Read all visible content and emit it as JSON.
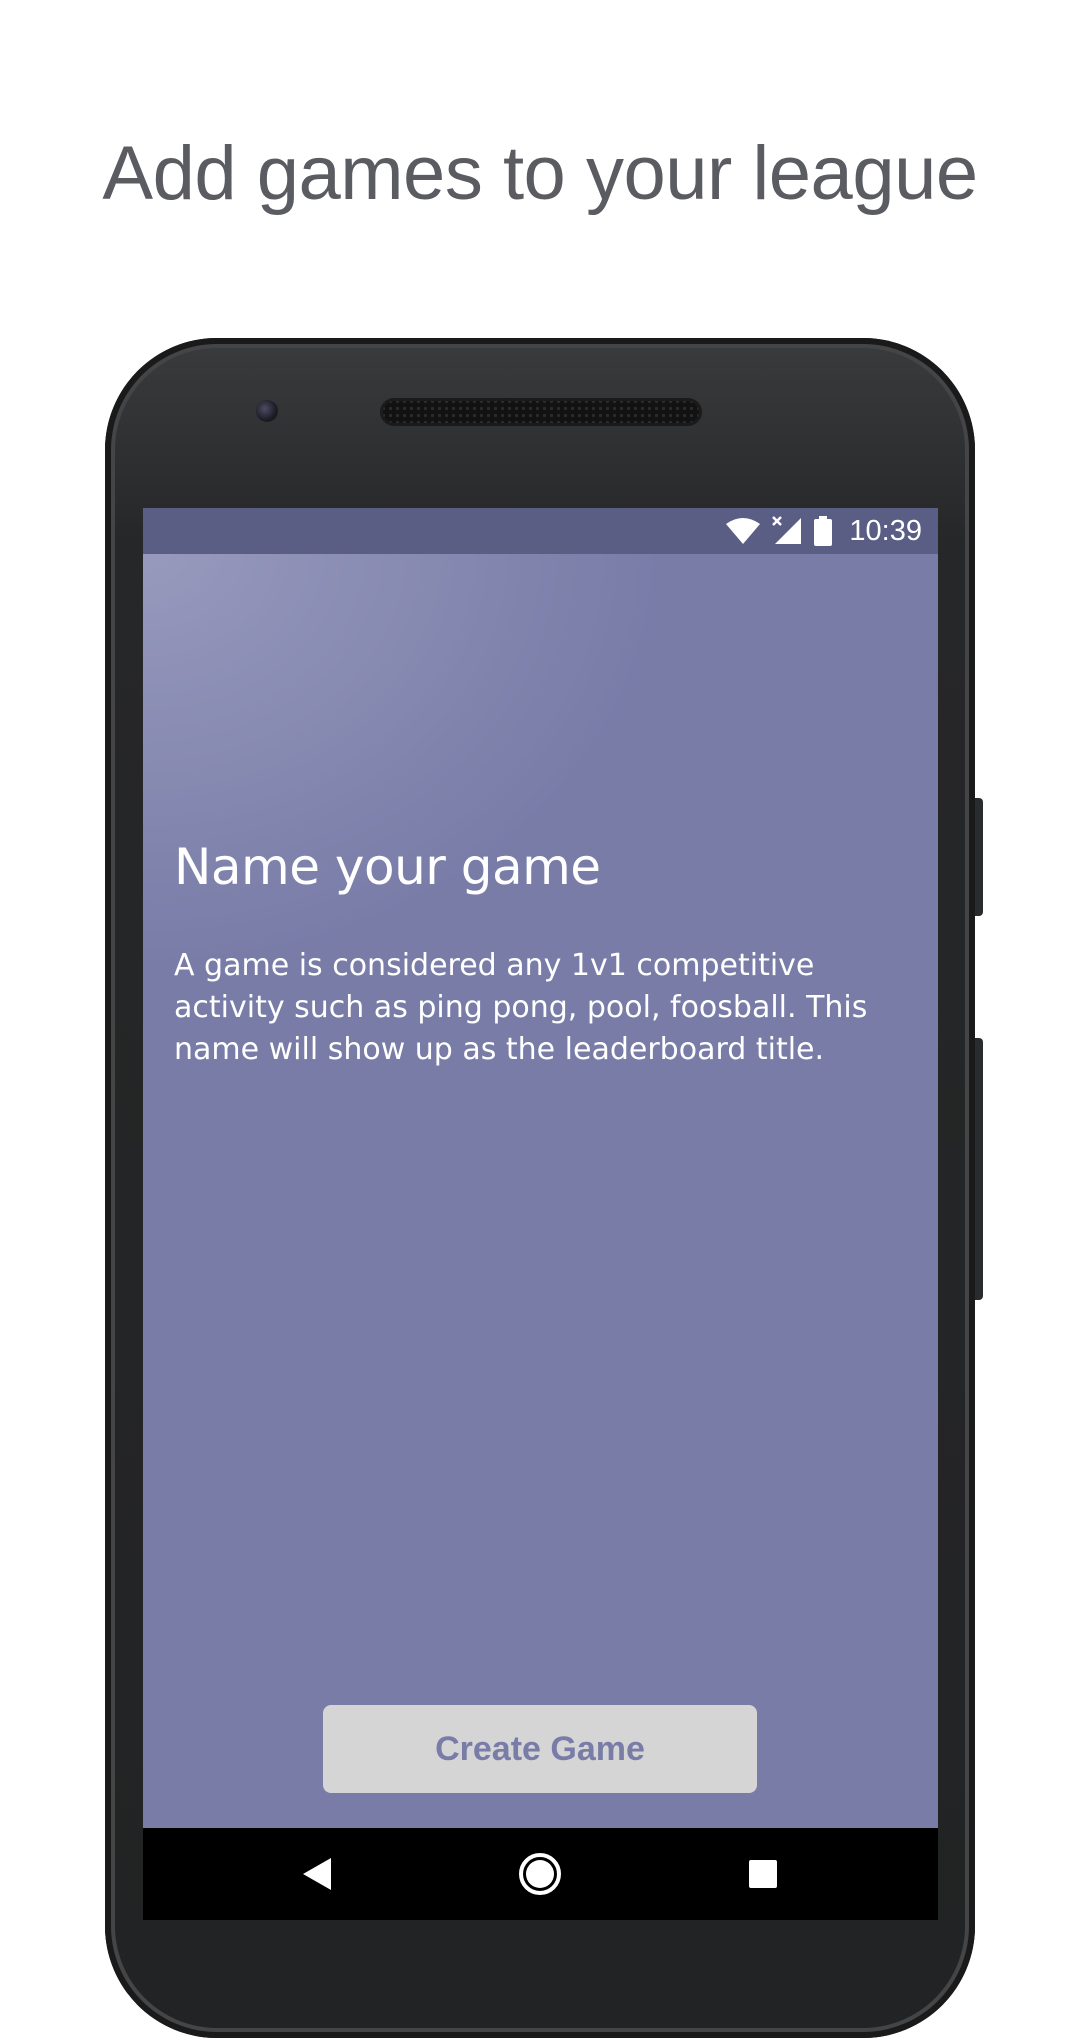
{
  "headline": "Add games to your league",
  "status_bar": {
    "time": "10:39",
    "icons": [
      "wifi-icon",
      "signal-icon",
      "battery-icon"
    ]
  },
  "screen": {
    "title": "Name your game",
    "description": "A game is considered any 1v1 competitive activity such as ping pong, pool, foosball. This name will show up as the leaderboard title.",
    "create_button_label": "Create Game"
  },
  "nav_bar": {
    "icons": [
      "back-icon",
      "home-icon",
      "recents-icon"
    ]
  },
  "colors": {
    "app_background": "#787ca7",
    "status_bar": "#5a5e85",
    "button_background": "#d5d5d6",
    "button_text": "#787ca7",
    "headline_text": "#5a5c62"
  }
}
